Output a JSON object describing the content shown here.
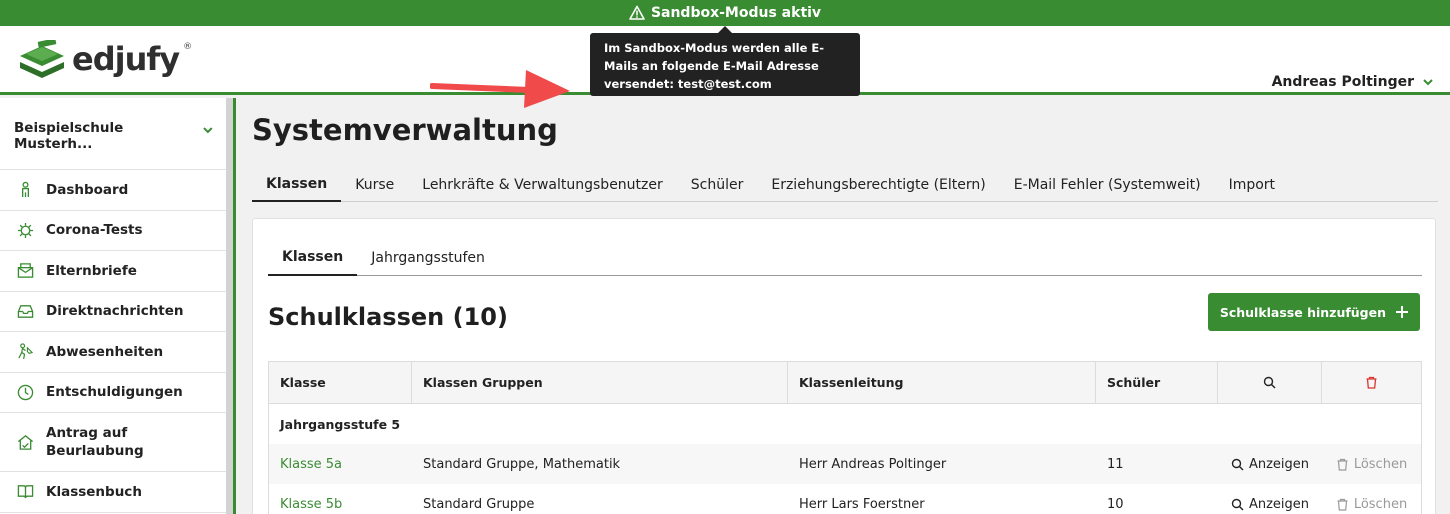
{
  "banner": {
    "text": "Sandbox-Modus aktiv",
    "icon": "warning-icon"
  },
  "header": {
    "logo_text": "edjufy",
    "logo_reg": "®",
    "tooltip": "Im Sandbox-Modus werden alle E-Mails an folgende E-Mail Adresse versendet: test@test.com",
    "user_name": "Andreas Poltinger"
  },
  "sidebar": {
    "school": "Beispielschule Musterh...",
    "items": [
      {
        "label": "Dashboard",
        "icon": "person-icon"
      },
      {
        "label": "Corona-Tests",
        "icon": "virus-icon"
      },
      {
        "label": "Elternbriefe",
        "icon": "letter-icon"
      },
      {
        "label": "Direktnachrichten",
        "icon": "inbox-icon"
      },
      {
        "label": "Abwesenheiten",
        "icon": "plane-person-icon"
      },
      {
        "label": "Entschuldigungen",
        "icon": "clock-icon"
      },
      {
        "label": "Antrag auf Beurlaubung",
        "icon": "house-icon"
      },
      {
        "label": "Klassenbuch",
        "icon": "book-icon"
      }
    ]
  },
  "main": {
    "title": "Systemverwaltung",
    "tabs": [
      "Klassen",
      "Kurse",
      "Lehrkräfte & Verwaltungsbenutzer",
      "Schüler",
      "Erziehungsberechtigte (Eltern)",
      "E-Mail Fehler (Systemweit)",
      "Import"
    ],
    "subtabs": [
      "Klassen",
      "Jahrgangsstufen"
    ],
    "section_title": "Schulklassen (10)",
    "add_button": "Schulklasse hinzufügen",
    "table": {
      "headers": [
        "Klasse",
        "Klassen Gruppen",
        "Klassenleitung",
        "Schüler"
      ],
      "group": "Jahrgangsstufe 5",
      "rows": [
        {
          "klasse": "Klasse 5a",
          "gruppen": "Standard Gruppe, Mathematik",
          "leitung": "Herr Andreas Poltinger",
          "schueler": "11",
          "show": "Anzeigen",
          "delete": "Löschen"
        },
        {
          "klasse": "Klasse 5b",
          "gruppen": "Standard Gruppe",
          "leitung": "Herr Lars Foerstner",
          "schueler": "10",
          "show": "Anzeigen",
          "delete": "Löschen"
        }
      ]
    }
  },
  "colors": {
    "brand_green": "#3a8c33",
    "danger_red": "#d9342b"
  }
}
